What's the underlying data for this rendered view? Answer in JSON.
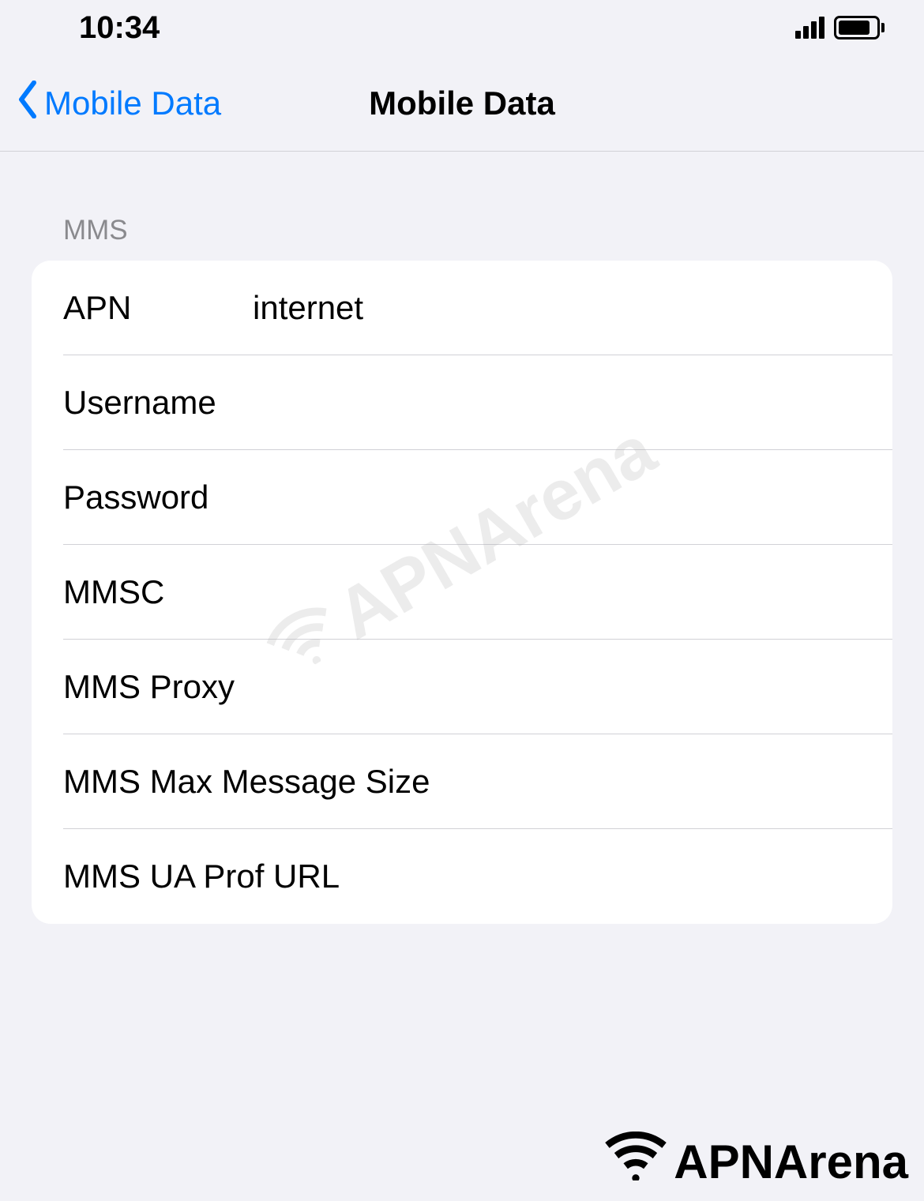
{
  "status_bar": {
    "time": "10:34"
  },
  "nav": {
    "back_label": "Mobile Data",
    "title": "Mobile Data"
  },
  "section": {
    "header": "MMS",
    "rows": [
      {
        "label": "APN",
        "value": "internet"
      },
      {
        "label": "Username",
        "value": ""
      },
      {
        "label": "Password",
        "value": ""
      },
      {
        "label": "MMSC",
        "value": ""
      },
      {
        "label": "MMS Proxy",
        "value": ""
      },
      {
        "label": "MMS Max Message Size",
        "value": ""
      },
      {
        "label": "MMS UA Prof URL",
        "value": ""
      }
    ]
  },
  "watermark": {
    "text": "APNArena"
  }
}
